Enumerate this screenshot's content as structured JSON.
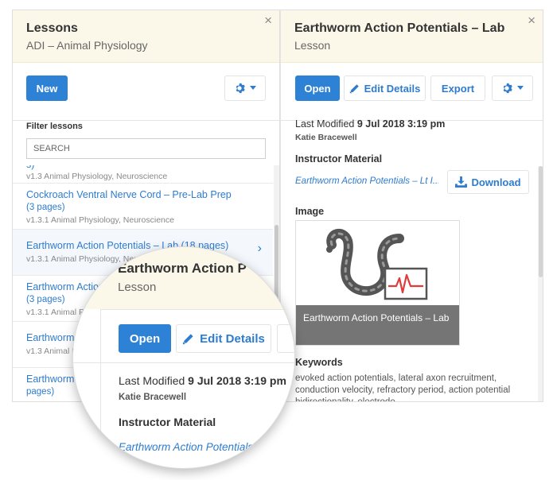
{
  "lessons_panel": {
    "title": "Lessons",
    "subtitle": "ADI – Animal Physiology",
    "close_label": "×",
    "new_label": "New",
    "filter_label": "Filter lessons",
    "filter_placeholder": "SEARCH",
    "items": [
      {
        "name": "s)",
        "pages": "",
        "meta": "v1.3 Animal Physiology, Neuroscience"
      },
      {
        "name": "Cockroach Ventral Nerve Cord – Pre-Lab Prep",
        "pages": "(3 pages)",
        "meta": "v1.3.1 Animal Physiology, Neuroscience"
      },
      {
        "name": "Earthworm Action Potentials – Lab (18 pages)",
        "pages": "",
        "meta": "v1.3.1 Animal Physiology, Neuroscience"
      },
      {
        "name": "Earthworm Action Potentials – Pre-Lab",
        "pages": "(3 pages)",
        "meta": "v1.3.1 Animal Physiology, Neuroscience"
      },
      {
        "name": "Earthworm Action Potentials",
        "pages": "",
        "meta": "v1.3 Animal Physiology"
      },
      {
        "name": "Earthworm Action Potentials –",
        "pages": "pages)",
        "meta": ""
      }
    ]
  },
  "detail_panel": {
    "title": "Earthworm Action Potentials – Lab",
    "subtitle": "Lesson",
    "close_label": "×",
    "open_label": "Open",
    "edit_label": "Edit Details",
    "export_label": "Export",
    "last_modified_label": "Last Modified",
    "last_modified_value": "9 Jul 2018  3:19 pm",
    "author": "Katie Bracewell",
    "instructor_material_label": "Instructor Material",
    "instructor_material_link": "Earthworm Action Potentials – Lt I...",
    "download_label": "Download",
    "image_label": "Image",
    "image_caption": "Earthworm Action Potentials – Lab",
    "keywords_label": "Keywords",
    "keywords": "evoked action potentials, lateral axon recruitment, conduction velocity, refractory period, action potential bidirectionality, electrode"
  },
  "magnifier": {
    "title": "Earthworm Action P",
    "subtitle": "Lesson",
    "open_label": "Open",
    "edit_label": "Edit Details",
    "last_modified_label": "Last Modified",
    "last_modified_value": "9 Jul 2018  3:19 pm",
    "author": "Katie Bracewell",
    "instructor_material_label": "Instructor Material",
    "instructor_material_link": "Earthworm Action Potentials"
  },
  "colors": {
    "accent": "#2e82d6",
    "header_bg": "#fbf8ea",
    "link": "#2e7ccf",
    "caption_bg": "#757575",
    "ecg_red": "#e03a3a"
  },
  "icons": [
    "close-icon",
    "gear-icon",
    "chevron-down-icon",
    "pencil-icon",
    "download-icon",
    "chevron-right-icon"
  ]
}
